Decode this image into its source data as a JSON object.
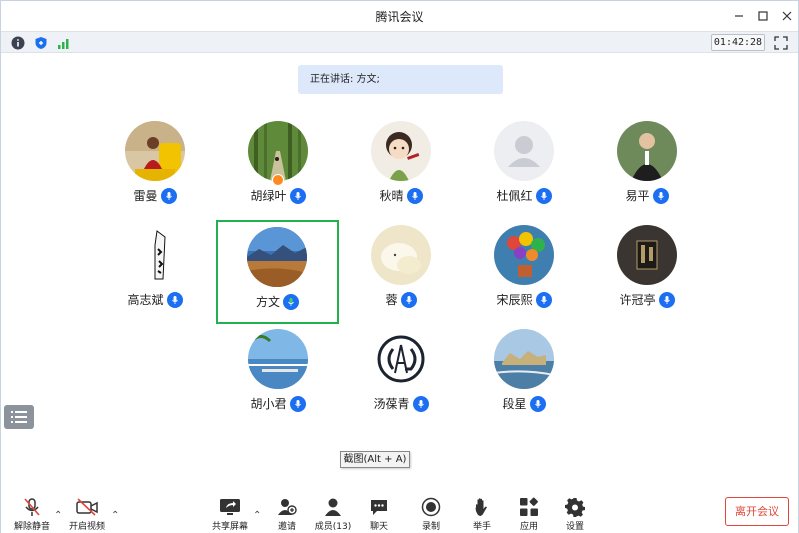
{
  "window": {
    "title": "腾讯会议"
  },
  "infobar": {
    "timer": "01:42:28"
  },
  "speaker_banner": {
    "text": "正在讲话: 方文;"
  },
  "participants": [
    {
      "name": "雷曼"
    },
    {
      "name": "胡绿叶"
    },
    {
      "name": "秋晴"
    },
    {
      "name": "杜佩红"
    },
    {
      "name": "易平"
    },
    {
      "name": "高志斌"
    },
    {
      "name": "方文"
    },
    {
      "name": "蓉"
    },
    {
      "name": "宋辰熙"
    },
    {
      "name": "许冠亭"
    },
    {
      "name": "胡小君"
    },
    {
      "name": "汤葆青"
    },
    {
      "name": "段星"
    }
  ],
  "tooltip": {
    "text": "截图(Alt + A)"
  },
  "toolbar": {
    "unmute": "解除静音",
    "start_video": "开启视频",
    "share_screen": "共享屏幕",
    "invite": "邀请",
    "members": "成员(13)",
    "chat": "聊天",
    "record": "录制",
    "raise_hand": "举手",
    "apps": "应用",
    "settings": "设置",
    "leave": "离开会议"
  },
  "colors": {
    "accent": "#1d6ff2",
    "active_border": "#22b14c",
    "leave": "#e0463a",
    "banner": "#dde9fb"
  }
}
